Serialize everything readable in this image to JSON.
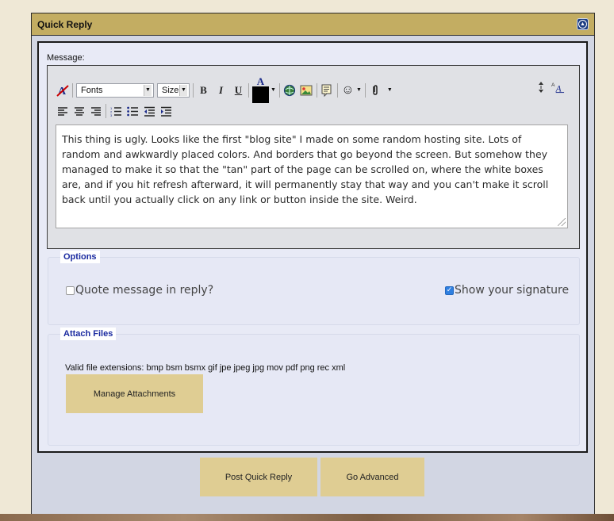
{
  "panel": {
    "title": "Quick Reply",
    "collapse_icon": "collapse-up-icon"
  },
  "editor": {
    "message_label": "Message:",
    "fonts_select": "Fonts",
    "size_select": "Size",
    "bold_label": "B",
    "italic_label": "I",
    "underline_label": "U",
    "font_color_label": "A",
    "font_color_value": "#000000",
    "toolbar_icons": [
      "remove-format-icon",
      "insert-link-icon",
      "insert-image-icon",
      "quote-icon",
      "smiley-icon",
      "attachment-icon",
      "resize-editor-icon",
      "switch-mode-icon",
      "align-left-icon",
      "align-center-icon",
      "align-right-icon",
      "ordered-list-icon",
      "unordered-list-icon",
      "outdent-icon",
      "indent-icon"
    ],
    "message_text": "This thing is ugly. Looks like the first \"blog site\" I made on some random hosting site. Lots of random and awkwardly placed colors. And borders that go beyond the screen. But somehow they managed to make it so that the \"tan\" part of the page can be scrolled on, where the white boxes are, and if you hit refresh afterward, it will permanently stay that way and you can't make it scroll back until you actually click on any link or button inside the site. Weird."
  },
  "options": {
    "legend": "Options",
    "quote_label": "Quote message in reply?",
    "quote_checked": false,
    "signature_label": "Show your signature",
    "signature_checked": true
  },
  "attach": {
    "legend": "Attach Files",
    "valid_extensions": "Valid file extensions: bmp bsm bsmx gif jpe jpeg jpg mov pdf png rec xml",
    "manage_button": "Manage Attachments"
  },
  "actions": {
    "post_button": "Post Quick Reply",
    "advanced_button": "Go Advanced"
  },
  "colors": {
    "header": "#c3ad62",
    "button": "#dfcd93",
    "page_bg": "#efe8d6",
    "legend_text": "#1a2aa0"
  }
}
